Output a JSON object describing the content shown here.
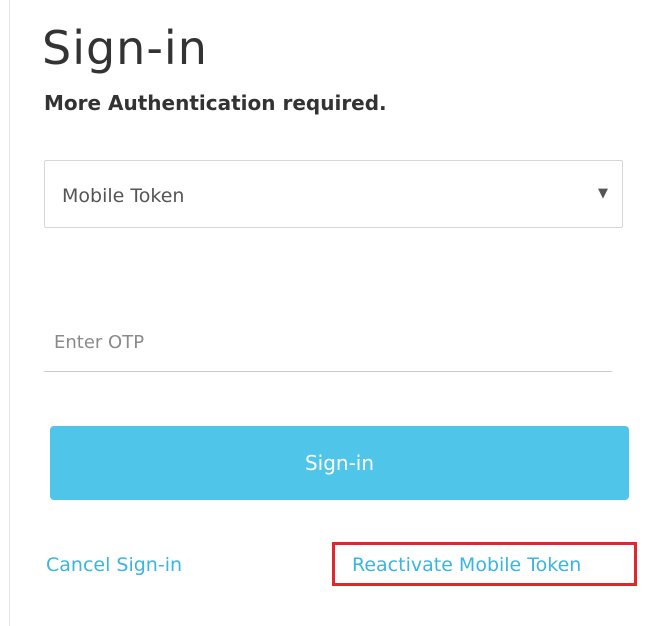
{
  "header": {
    "title": "Sign-in",
    "subtitle": "More Authentication required."
  },
  "auth_method": {
    "selected": "Mobile Token",
    "caret_icon": "caret-down-icon"
  },
  "otp": {
    "value": "",
    "placeholder": "Enter OTP"
  },
  "actions": {
    "signin_label": "Sign-in",
    "cancel_label": "Cancel Sign-in",
    "reactivate_label": "Reactivate Mobile Token"
  },
  "colors": {
    "primary_button": "#4fc5e9",
    "link": "#3ab5df",
    "highlight_border": "#e3262b",
    "text": "#333333"
  }
}
